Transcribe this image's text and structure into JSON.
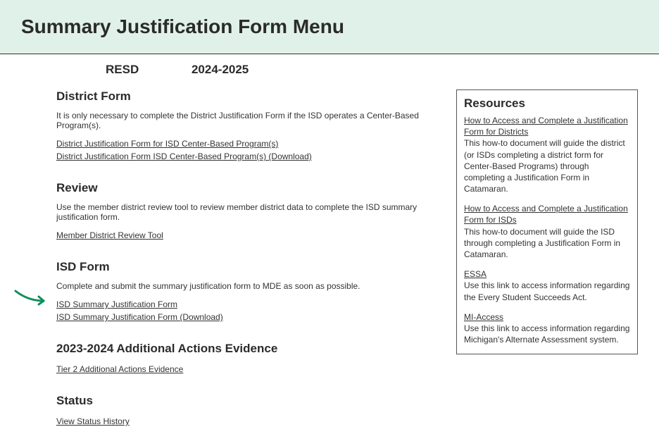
{
  "header": {
    "title": "Summary Justification Form Menu"
  },
  "subheader": {
    "entity": "RESD",
    "year": "2024-2025"
  },
  "sections": {
    "district": {
      "heading": "District Form",
      "desc": "It is only necessary to complete the District Justification Form if the ISD operates a Center-Based Program(s).",
      "link1": "District Justification Form for ISD Center-Based Program(s)",
      "link2": "District Justification Form ISD Center-Based Program(s) (Download)"
    },
    "review": {
      "heading": "Review",
      "desc": "Use the member district review tool to review member district data to complete the ISD summary justification form.",
      "link1": "Member District Review Tool"
    },
    "isd": {
      "heading": "ISD Form",
      "desc": "Complete and submit the summary justification form to MDE as soon as possible.",
      "link1": "ISD Summary Justification Form",
      "link2": "ISD Summary Justification Form (Download)"
    },
    "evidence": {
      "heading": "2023-2024 Additional Actions Evidence",
      "link1": "Tier 2 Additional Actions Evidence"
    },
    "status": {
      "heading": "Status",
      "link1": "View Status History"
    }
  },
  "resources": {
    "heading": "Resources",
    "items": [
      {
        "link": "How to Access and Complete a Justification Form for Districts",
        "desc": "This how-to document will guide the district (or ISDs completing a district form for Center-Based Programs) through completing a Justification Form in Catamaran."
      },
      {
        "link": "How to Access and Complete a Justification Form for ISDs",
        "desc": "This how-to document will guide the ISD through completing a Justification Form in Catamaran."
      },
      {
        "link": "ESSA",
        "desc": "Use this link to access information regarding the Every Student Succeeds Act."
      },
      {
        "link": "MI-Access",
        "desc": "Use this link to access information regarding Michigan's Alternate Assessment system."
      }
    ]
  }
}
